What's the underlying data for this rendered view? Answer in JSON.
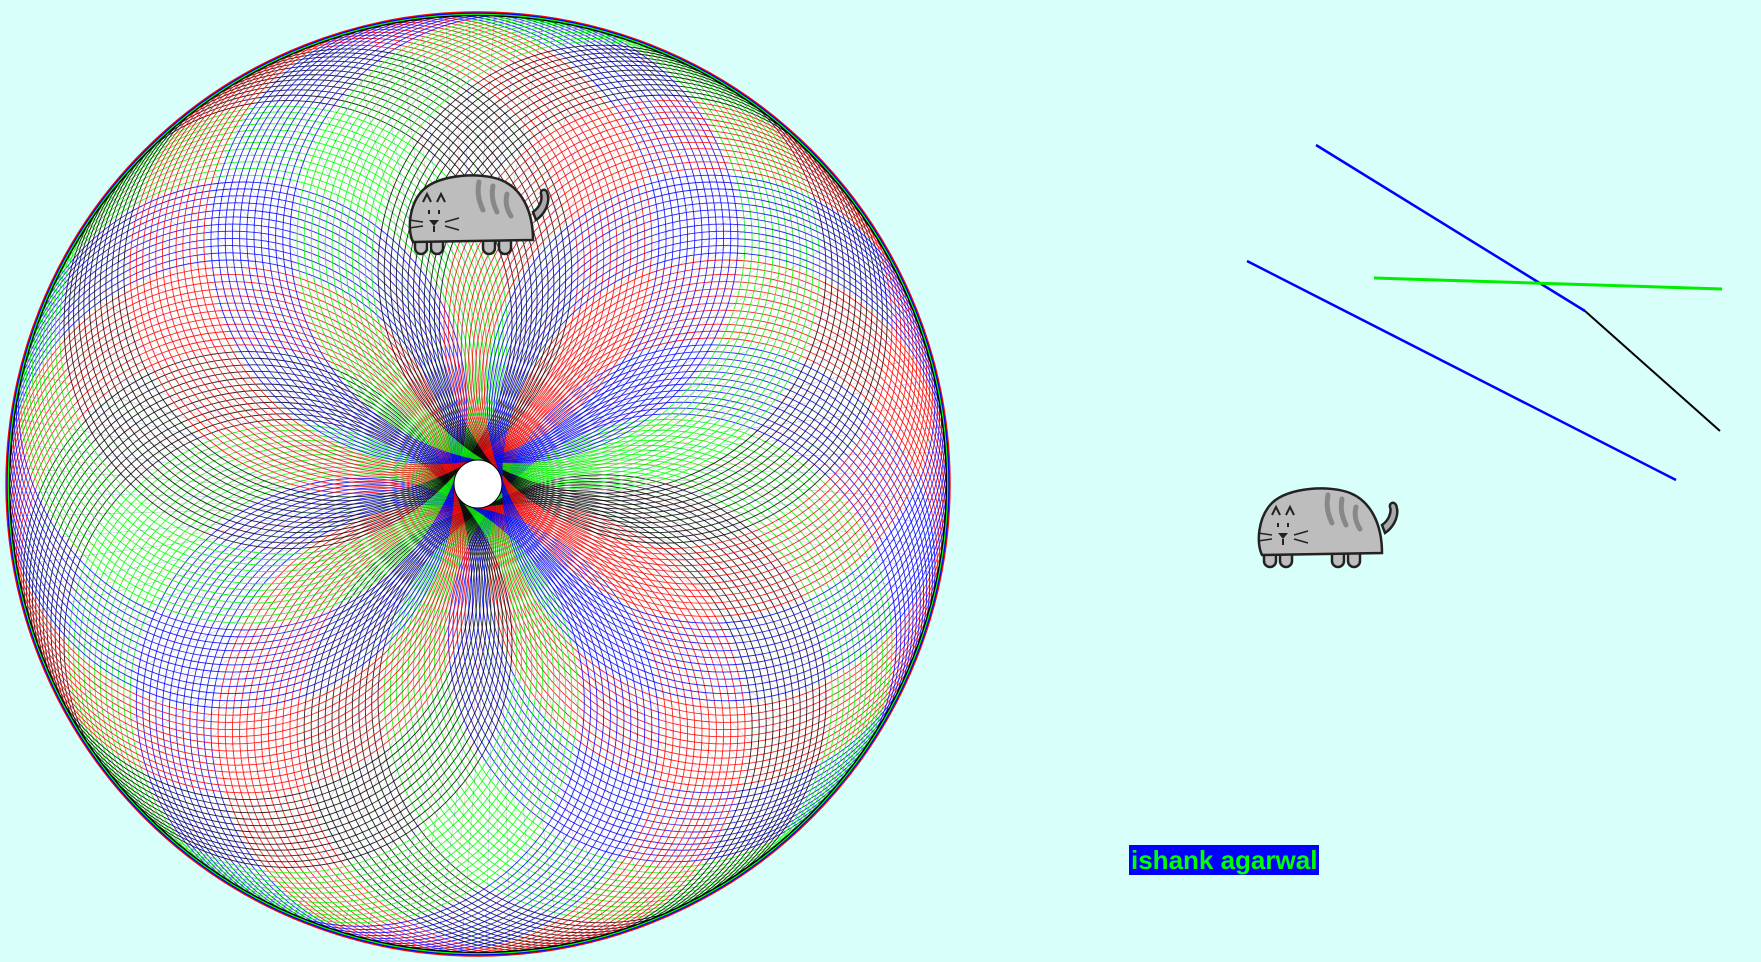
{
  "canvas": {
    "background": "#d9fffb"
  },
  "pattern": {
    "colors": [
      "#ff0000",
      "#0000ff",
      "#00ff00",
      "#000000"
    ],
    "hole_color": "#ffffff"
  },
  "lines_color_order": [
    "blue",
    "blue",
    "green",
    "black"
  ],
  "line_colors": {
    "blue": "#0000ff",
    "green": "#00ee00",
    "black": "#000000"
  },
  "sprites": [
    {
      "name": "cat-sprite",
      "icon": "cat-icon"
    },
    {
      "name": "cat-sprite",
      "icon": "cat-icon"
    }
  ],
  "label": {
    "text": "ishank agarwal",
    "background": "#0000ff",
    "color": "#00ff00"
  }
}
